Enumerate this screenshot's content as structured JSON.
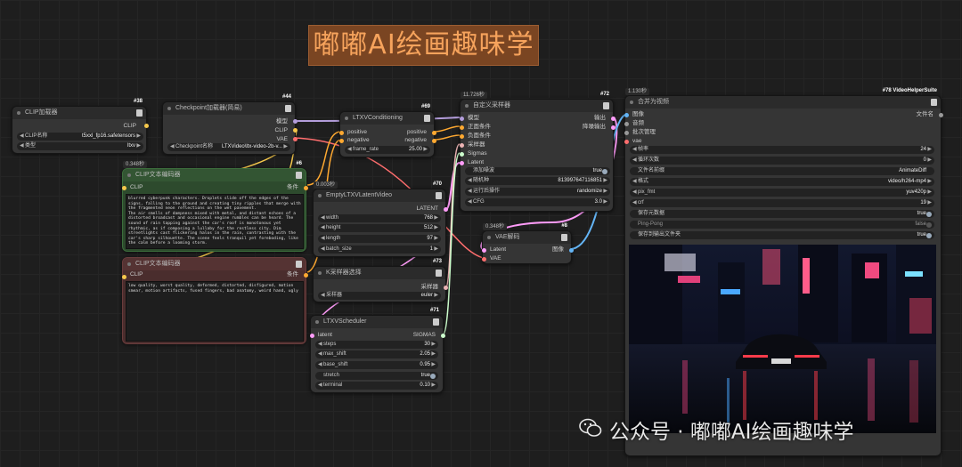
{
  "banner": "嘟嘟AI绘画趣味学",
  "watermark": "公众号 · 嘟嘟AI绘画趣味学",
  "nodes": {
    "clip_loader": {
      "id": "#38",
      "title": "CLIP加载器",
      "out": "CLIP",
      "w1_label": "CLIP名称",
      "w1_value": "t5xxl_fp16.safetensors",
      "w2_label": "类型",
      "w2_value": "ltxv"
    },
    "ckpt": {
      "id": "#44",
      "title": "Checkpoint加载器(简易)",
      "out1": "模型",
      "out2": "CLIP",
      "out3": "VAE",
      "w1_label": "Checkpoint名称",
      "w1_value": "LTXVideo\\ltx-video-2b-v..."
    },
    "cond": {
      "id": "#69",
      "title": "LTXVConditioning",
      "in1": "positive",
      "in2": "negative",
      "out1": "positive",
      "out2": "negative",
      "w1_label": "frame_rate",
      "w1_value": "25.00"
    },
    "sampler": {
      "id": "#72",
      "time": "11.726秒",
      "title": "自定义采样器",
      "in1": "模型",
      "in2": "正面条件",
      "in3": "负面条件",
      "in4": "采样器",
      "in5": "Sigmas",
      "in6": "Latent",
      "out1": "输出",
      "out2": "降噪输出",
      "w1_label": "添加噪波",
      "w1_value": "true",
      "w2_label": "随机种",
      "w2_value": "813997647116851",
      "w3_label": "运行后操作",
      "w3_value": "randomize",
      "w4_label": "CFG",
      "w4_value": "3.0"
    },
    "clip_pos": {
      "id": "#6",
      "time": "0.348秒",
      "title": "CLIP文本编码器",
      "in": "CLIP",
      "out": "条件",
      "text": "blurred cyberpunk characters. Droplets slide off the edges of the signs, falling to the ground and creating tiny ripples that merge with the fragmented neon reflections on the wet pavement.\nThe air smells of dampness mixed with metal, and distant echoes of a distorted broadcast and occasional engine rumbles can be heard. The sound of rain tapping against the car's roof is monotonous yet rhythmic, as if composing a lullaby for the restless city. Dim streetlights cast flickering halos in the rain, contrasting with the car's sharp silhouette. The scene feels tranquil yet foreboding, like the calm before a looming storm."
    },
    "clip_neg": {
      "id": "",
      "title": "CLIP文本编码器",
      "in": "CLIP",
      "out": "条件",
      "text": "low quality, worst quality, deformed, distorted, disfigured, motion smear, motion artifacts, fused fingers, bad anatomy, weird hand, ugly"
    },
    "latent": {
      "id": "#70",
      "time": "0.003秒",
      "title": "EmptyLTXVLatentVideo",
      "out": "LATENT",
      "w1_label": "width",
      "w1_value": "768",
      "w2_label": "height",
      "w2_value": "512",
      "w3_label": "length",
      "w3_value": "97",
      "w4_label": "batch_size",
      "w4_value": "1"
    },
    "ksel": {
      "id": "#73",
      "title": "K采样器选择",
      "out": "采样器",
      "w1_label": "采样器",
      "w1_value": "euler"
    },
    "sched": {
      "id": "#71",
      "title": "LTXVScheduler",
      "in": "latent",
      "out": "SIGMAS",
      "w1_label": "steps",
      "w1_value": "30",
      "w2_label": "max_shift",
      "w2_value": "2.05",
      "w3_label": "base_shift",
      "w3_value": "0.95",
      "w4_label": "stretch",
      "w4_value": "true",
      "w5_label": "terminal",
      "w5_value": "0.10"
    },
    "vae": {
      "id": "#8",
      "time": "0.348秒",
      "title": "VAE解码",
      "in1": "Latent",
      "in2": "VAE",
      "out": "图像"
    },
    "combine": {
      "id": "#78 VideoHelperSuite",
      "time": "1.130秒",
      "title": "合并为视频",
      "in1": "图像",
      "in2": "音频",
      "in3": "批次管理",
      "in4": "vae",
      "out": "文件名",
      "w1_label": "帧率",
      "w1_value": "24",
      "w2_label": "循环次数",
      "w2_value": "0",
      "w3_label": "文件名前缀",
      "w3_value": "AnimateDiff",
      "w4_label": "格式",
      "w4_value": "video/h264-mp4",
      "w5_label": "pix_fmt",
      "w5_value": "yuv420p",
      "w6_label": "crf",
      "w6_value": "19",
      "w7_label": "保存元数据",
      "w7_value": "true",
      "w8_label": "Ping-Pong",
      "w8_value": "false",
      "w9_label": "保存到输出文件夹",
      "w9_value": "true"
    }
  },
  "colors": {
    "clip": "#f5c84c",
    "model": "#b39ddb",
    "vae": "#ff6e6e",
    "cond": "#ffa931",
    "latent": "#ff9cf9",
    "image": "#64b5f6",
    "sampler": "#ecb4b4",
    "sigmas": "#cdffcd"
  }
}
